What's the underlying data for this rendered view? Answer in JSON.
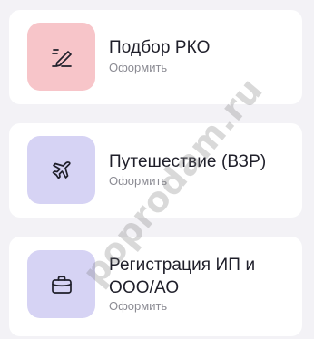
{
  "items": [
    {
      "title": "Подбор РКО",
      "subtitle": "Оформить",
      "icon": "signature-pen-icon",
      "tile_color": "#f7c5c9"
    },
    {
      "title": "Путешествие (ВЗР)",
      "subtitle": "Оформить",
      "icon": "airplane-icon",
      "tile_color": "#d6d3f4"
    },
    {
      "title": "Регистрация ИП и ООО/АО",
      "subtitle": "Оформить",
      "icon": "briefcase-icon",
      "tile_color": "#d6d3f4"
    }
  ],
  "watermark": "poprodam.ru"
}
